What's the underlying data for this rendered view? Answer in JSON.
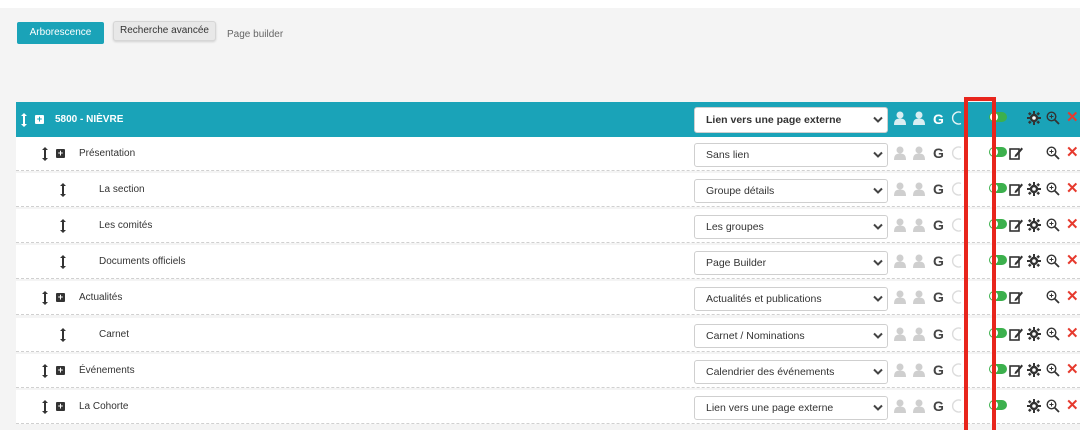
{
  "toolbar": {
    "tree_button": "Arborescence",
    "advanced_button": "Recherche avancée",
    "page_builder_link": "Page builder"
  },
  "rows": [
    {
      "label": "5800 - NIÈVRE",
      "select": "Lien vers une page externe",
      "level": 0,
      "has_expand": true,
      "root": true,
      "edit": false,
      "gear": true
    },
    {
      "label": "Présentation",
      "select": "Sans lien",
      "level": 1,
      "has_expand": true,
      "edit": true,
      "gear": false
    },
    {
      "label": "La section",
      "select": "Groupe détails",
      "level": 2,
      "has_expand": false,
      "edit": true,
      "gear": true
    },
    {
      "label": "Les comités",
      "select": "Les groupes",
      "level": 2,
      "has_expand": false,
      "edit": true,
      "gear": true
    },
    {
      "label": "Documents officiels",
      "select": "Page Builder",
      "level": 2,
      "has_expand": false,
      "edit": true,
      "gear": true
    },
    {
      "label": "Actualités",
      "select": "Actualités et publications",
      "level": 1,
      "has_expand": true,
      "edit": true,
      "gear": false
    },
    {
      "label": "Carnet",
      "select": "Carnet / Nominations",
      "level": 2,
      "has_expand": false,
      "edit": true,
      "gear": true
    },
    {
      "label": "Événements",
      "select": "Calendrier des événements",
      "level": 1,
      "has_expand": true,
      "edit": true,
      "gear": true
    },
    {
      "label": "La Cohorte",
      "select": "Lien vers une page externe",
      "level": 1,
      "has_expand": true,
      "edit": false,
      "gear": true
    }
  ],
  "icons": {
    "drag": "drag-handle-icon",
    "expand": "expand-plus-icon",
    "user": "user-icon",
    "google": "google-icon",
    "toggle": "toggle-on-icon",
    "edit": "edit-icon",
    "gear": "gear-icon",
    "zoom": "zoom-icon",
    "delete": "delete-icon",
    "chevron": "chevron-down-icon"
  },
  "colors": {
    "accent": "#1aa3b8",
    "toggle_on": "#3cb04d",
    "delete": "#e63a2e",
    "highlight": "#e8251c"
  }
}
